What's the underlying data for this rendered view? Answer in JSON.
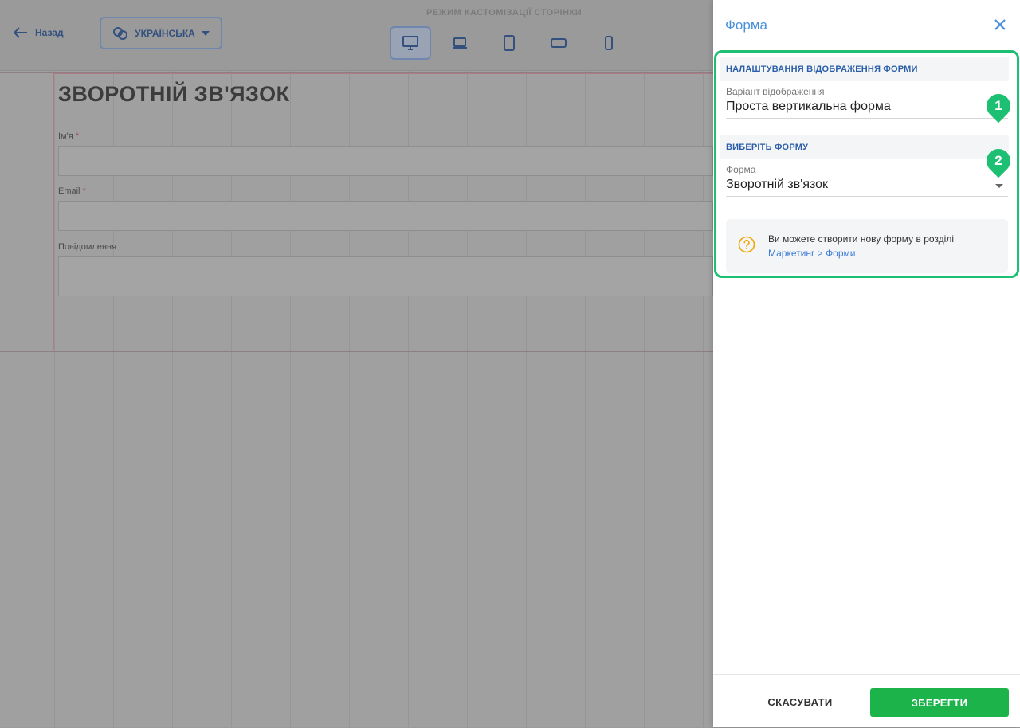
{
  "editor": {
    "back_label": "Назад",
    "language_label": "УКРАЇНСЬКА",
    "mode_label": "РЕЖИМ КАСТОМІЗАЦІЇ СТОРІНКИ",
    "devices": [
      "desktop-icon",
      "laptop-icon",
      "tablet-icon",
      "tablet-landscape-icon",
      "mobile-icon"
    ],
    "active_device": "desktop-icon",
    "form_title": "ЗВОРОТНІЙ ЗВ'ЯЗОК",
    "fields": [
      {
        "label": "Ім'я",
        "required": "*"
      },
      {
        "label": "Email",
        "required": "*"
      },
      {
        "label": "Повідомлення",
        "required": ""
      }
    ]
  },
  "panel": {
    "title": "Форма",
    "section1": {
      "heading": "НАЛАШТУВАННЯ ВІДОБРАЖЕННЯ ФОРМИ",
      "field_label": "Варіант відображення",
      "field_value": "Проста вертикальна форма",
      "badge": "1"
    },
    "section2": {
      "heading": "ВИБЕРІТЬ ФОРМУ",
      "field_label": "Форма",
      "field_value": "Зворотній зв'язок",
      "badge": "2"
    },
    "info": {
      "text": "Ви можете створити нову форму в розділі ",
      "link": "Маркетинг > Форми"
    },
    "footer": {
      "cancel_label": "СКАСУВАТИ",
      "save_label": "ЗБЕРЕГТИ"
    }
  },
  "colors": {
    "accent": "#1dbf73",
    "save": "#1bb34a",
    "link": "#3a7bd5",
    "heading": "#2a5ea8",
    "info_icon": "#f0a500"
  }
}
